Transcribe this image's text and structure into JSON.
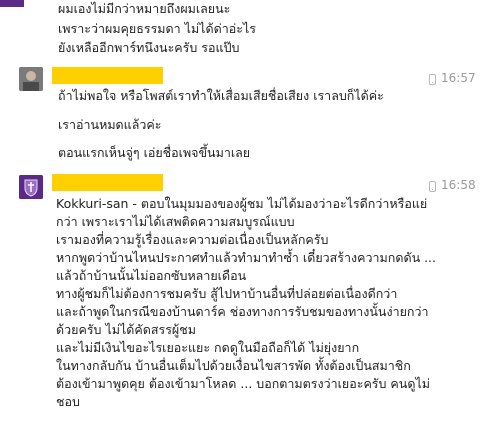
{
  "messages": [
    {
      "lines": [
        "ผมเองไม่มีกว่าหมายถึงผมเลยนะ",
        "เพราะว่าผมคุยธรรมดา ไม่ได้ด่าอ่ะไร",
        "ยังเหลืออีกพาร์ทนึงนะครับ รอแป๊บ"
      ]
    },
    {
      "time": "16:57",
      "lines": [
        "ถ้าไม่พอใจ หรือโพสต์เราทำให้เสื่อมเสียชื่อเสียง เราลบก็ได้ค่ะ",
        "เราอ่านหมดแล้วค่ะ",
        "ตอนแรกเห็นจู่ๆ เอ่ยชื่อเพจขึ้นมาเลย"
      ]
    },
    {
      "time": "16:58",
      "lines": [
        "Kokkuri-san - ตอบในมุมมองของผู้ชม ไม่ได้มองว่าอะไรดีกว่าหรือแย่",
        "กว่า เพราะเราไม่ได้เสพติดความสมบูรณ์แบบ",
        "เรามองที่ความรู้เรื่องและความต่อเนื่องเป็นหลักครับ",
        "หากพูดว่าบ้านไหนประกาศทำแล้วทำมาทำซ้ำ เดี๋ยวสร้างความกดดัน ...",
        "แล้วถ้าบ้านนั้นไม่ออกซับหลายเดือน",
        "ทางผู้ชมก็ไม่ต้องการชมครับ สู้ไปหาบ้านอื่นที่ปล่อยต่อเนื่องดีกว่า",
        "และถ้าพูดในกรณีของบ้านดาร์ค ช่องทางการรับชมของทางนั้นง่ายกว่า",
        "ด้วยครับ ไม่ได้คัดสรรผู้ชม",
        "และไม่มีเงินไขอะไรเยอะแยะ กดดูในมือถือก็ได้ ไม่ยุ่งยาก",
        "ในทางกลับกัน บ้านอื่นเต็มไปด้วยเงื่อนไขสารพัด ทั้งต้องเป็นสมาชิก",
        "ต้องเข้ามาพูดคุย ต้องเข้ามาโหลด ... บอกตามตรงว่าเยอะครับ คนดูไม่",
        "ชอบ"
      ]
    }
  ]
}
